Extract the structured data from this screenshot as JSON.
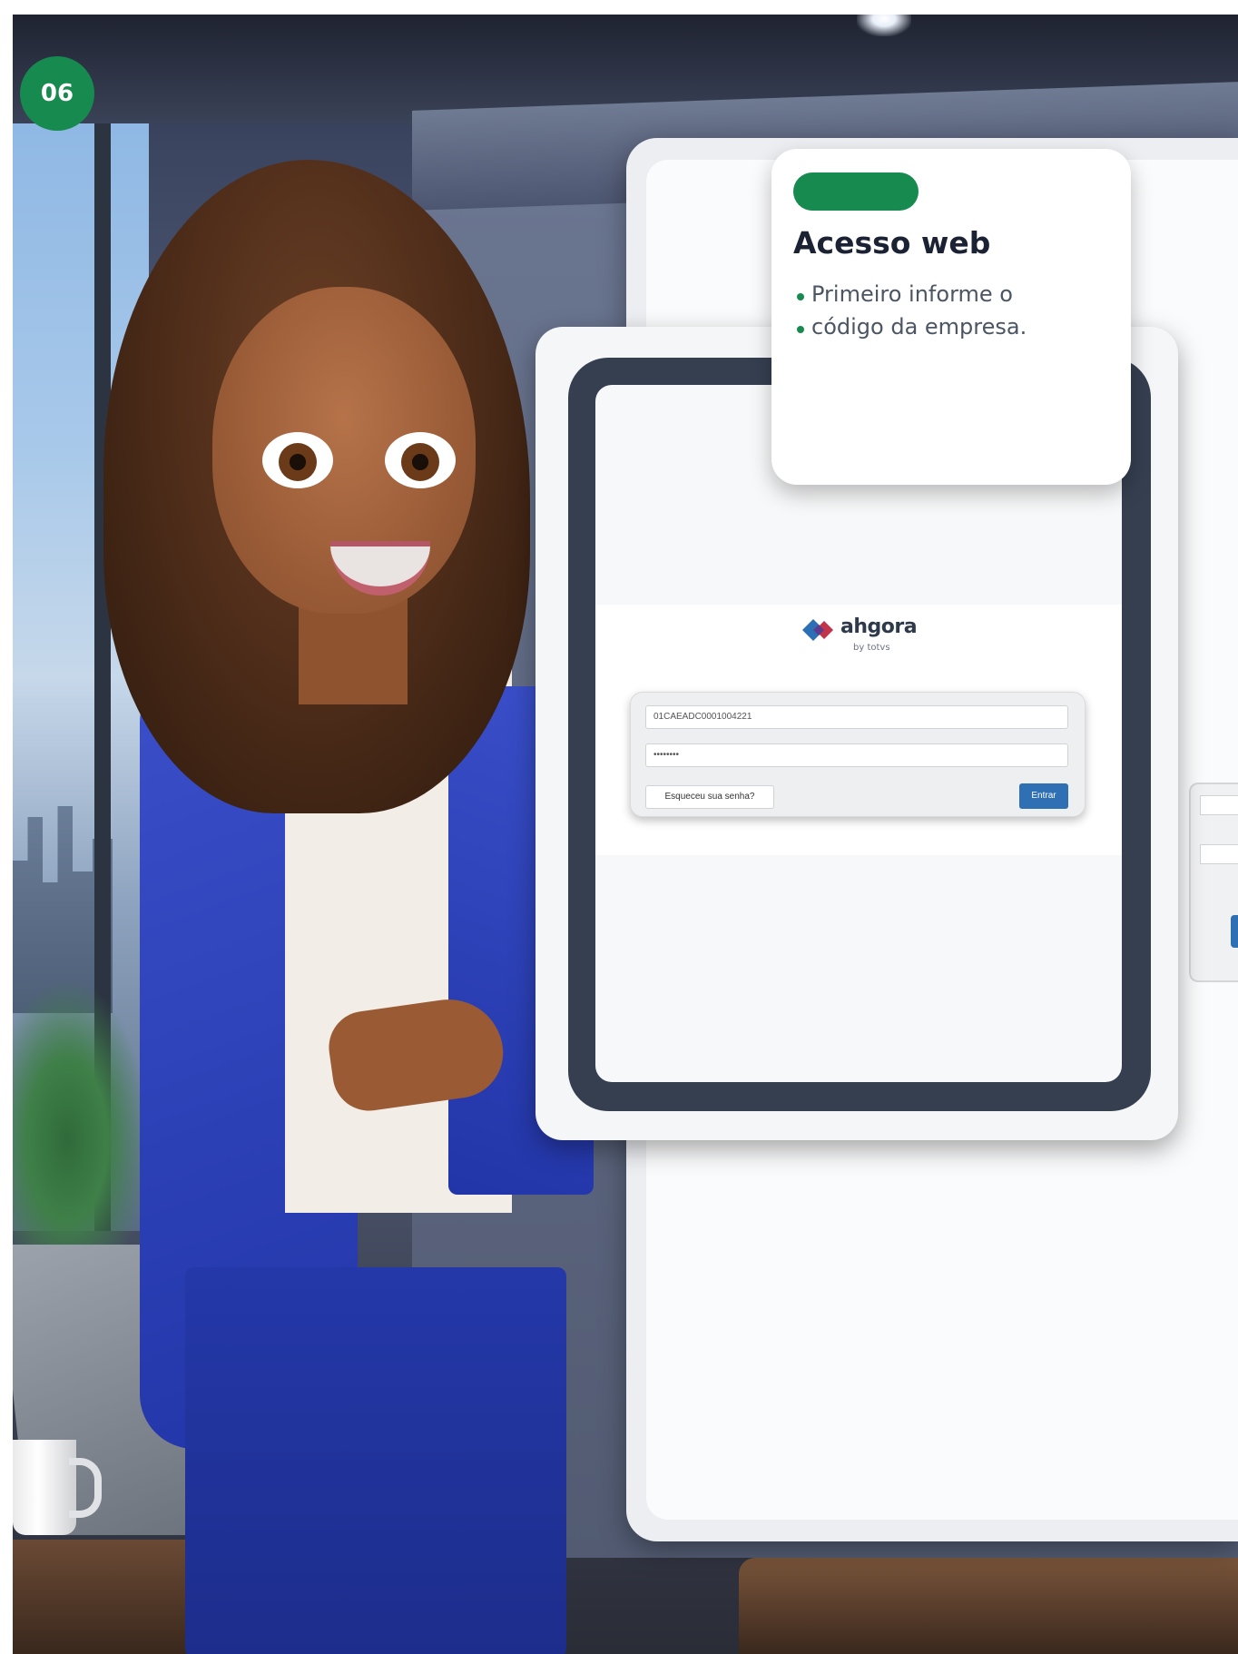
{
  "step_badge": "06",
  "callout": {
    "title": "Acesso web",
    "bullets": [
      "Primeiro informe o",
      "código da empresa."
    ]
  },
  "tablet": {
    "logo_text": "ahgora",
    "logo_byline": "by totvs",
    "company_code_value": "01CAEADC0001004221",
    "password_mask": "••••••••",
    "forgot_password_label": "Esqueceu sua senha?",
    "enter_label": "Entrar"
  },
  "colors": {
    "accent_green": "#178a4f",
    "button_blue": "#2f6fb3",
    "tablet_bezel": "#353f50"
  },
  "icons": {
    "logo": "ahgora-diamond-icon"
  }
}
